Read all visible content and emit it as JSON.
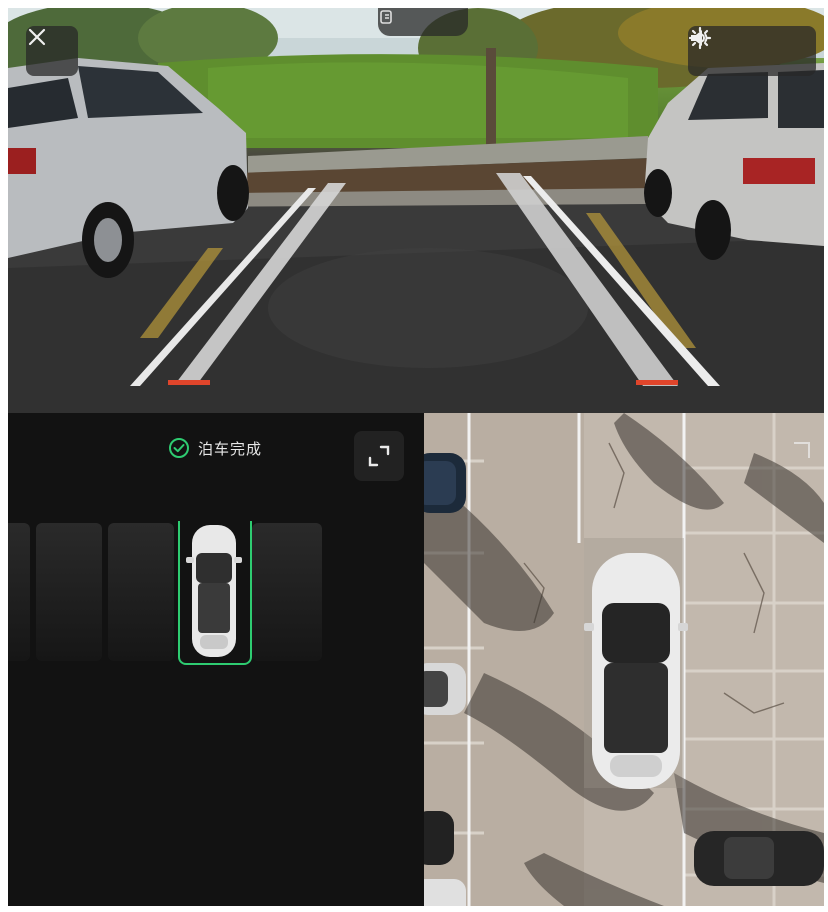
{
  "camera": {
    "close_icon": "close-icon",
    "top_tab_icon": "camera-switch-icon",
    "volume_icon": "volume-icon",
    "settings_icon": "gear-icon"
  },
  "panel": {
    "status_text": "泊车完成",
    "status_icon": "check-circle-icon",
    "status_color": "#2ecc71",
    "expand_icon": "expand-icon"
  }
}
